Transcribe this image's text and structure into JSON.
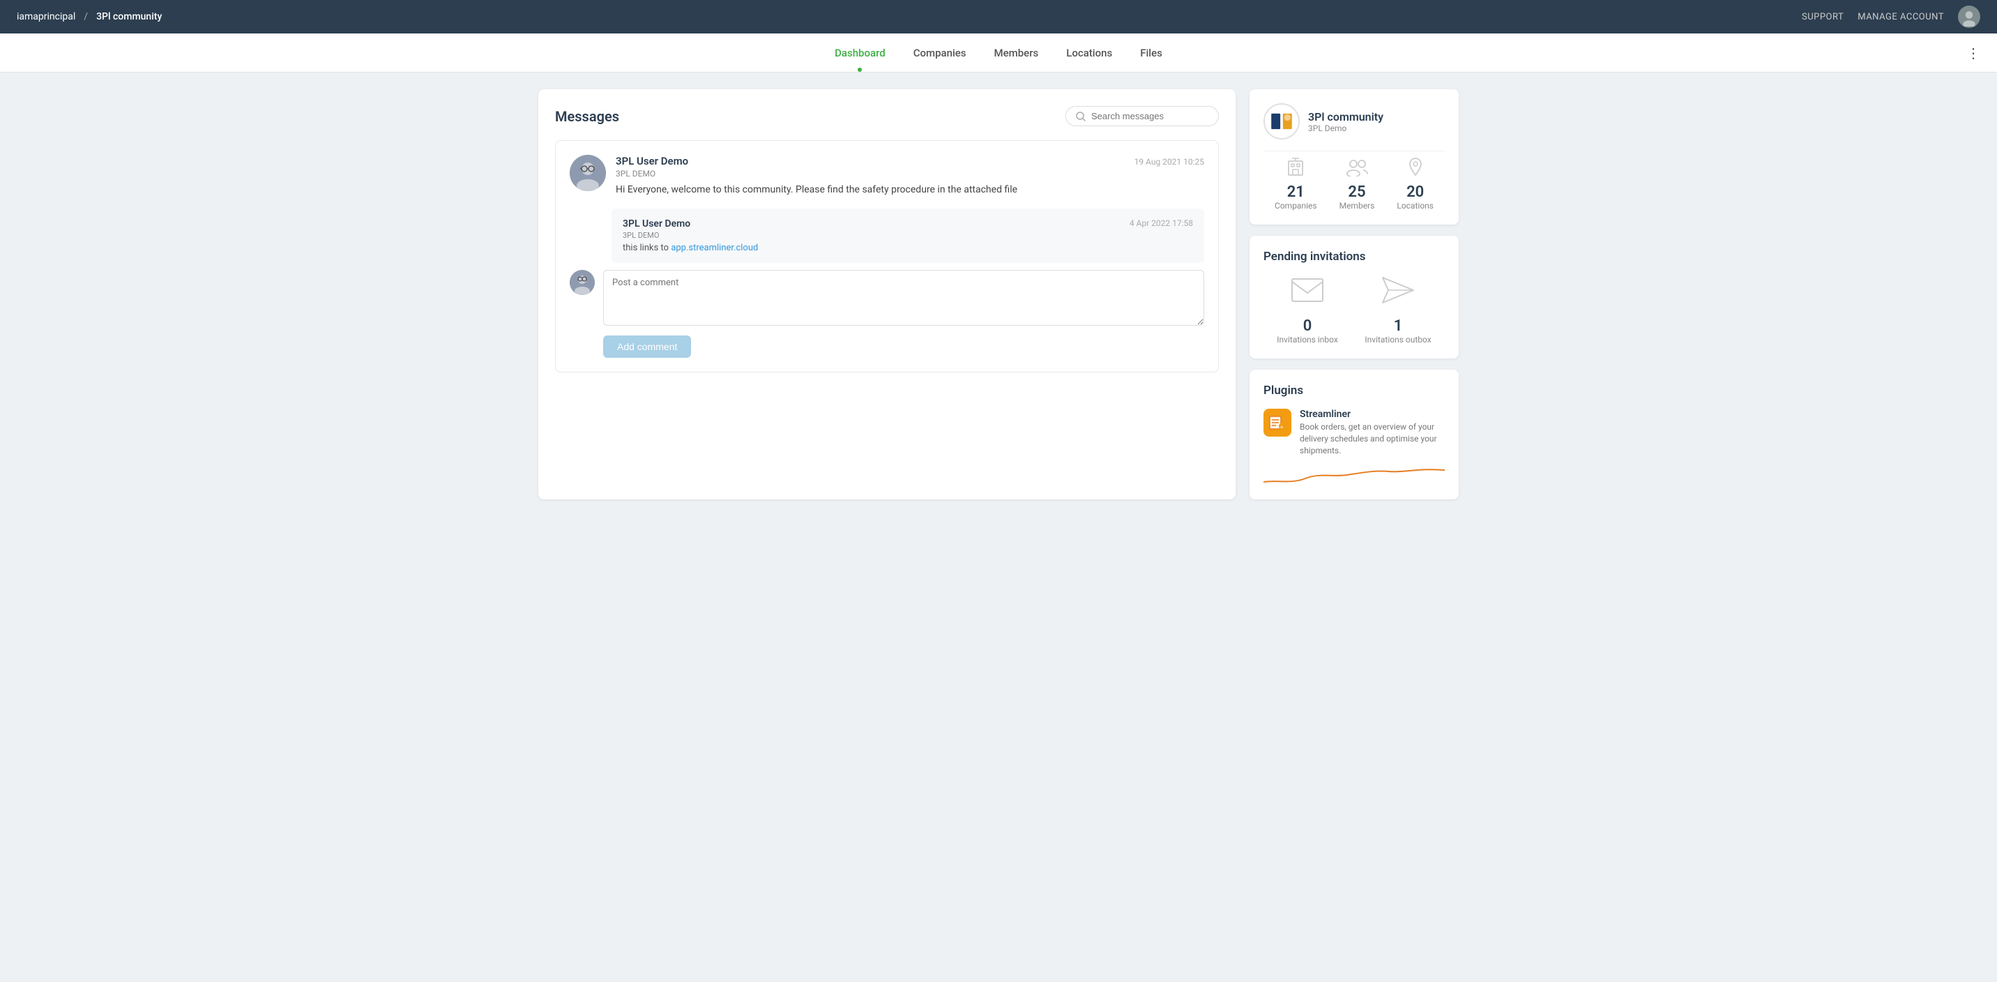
{
  "topbar": {
    "username": "iamaprincipal",
    "separator": "/",
    "community": "3Pl community",
    "support_label": "SUPPORT",
    "manage_account_label": "MANAGE ACCOUNT"
  },
  "mainnav": {
    "items": [
      {
        "id": "dashboard",
        "label": "Dashboard",
        "active": true
      },
      {
        "id": "companies",
        "label": "Companies",
        "active": false
      },
      {
        "id": "members",
        "label": "Members",
        "active": false
      },
      {
        "id": "locations",
        "label": "Locations",
        "active": false
      },
      {
        "id": "files",
        "label": "Files",
        "active": false
      }
    ],
    "more_icon": "⋮"
  },
  "messages": {
    "title": "Messages",
    "search_placeholder": "Search messages",
    "thread": {
      "author": "3PL User Demo",
      "company": "3PL DEMO",
      "timestamp": "19 Aug 2021 10:25",
      "text": "Hi Everyone, welcome to this community. Please find the safety procedure in the attached file",
      "reply": {
        "author": "3PL User Demo",
        "company": "3PL DEMO",
        "timestamp": "4 Apr 2022 17:58",
        "text": "this links to ",
        "link_text": "app.streamliner.cloud",
        "link_url": "https://app.streamliner.cloud"
      }
    },
    "comment_placeholder": "Post a comment",
    "add_comment_label": "Add comment"
  },
  "community_card": {
    "name": "3Pl community",
    "sub": "3PL Demo",
    "stats": {
      "companies": {
        "count": 21,
        "label": "Companies"
      },
      "members": {
        "count": 25,
        "label": "Members"
      },
      "locations": {
        "count": 20,
        "label": "Locations"
      }
    }
  },
  "pending_invitations": {
    "title": "Pending invitations",
    "inbox": {
      "count": 0,
      "label": "Invitations inbox"
    },
    "outbox": {
      "count": 1,
      "label": "Invitations outbox"
    }
  },
  "plugins": {
    "title": "Plugins",
    "items": [
      {
        "id": "streamliner",
        "name": "Streamliner",
        "description": "Book orders, get an overview of your delivery schedules and optimise your shipments."
      }
    ]
  }
}
